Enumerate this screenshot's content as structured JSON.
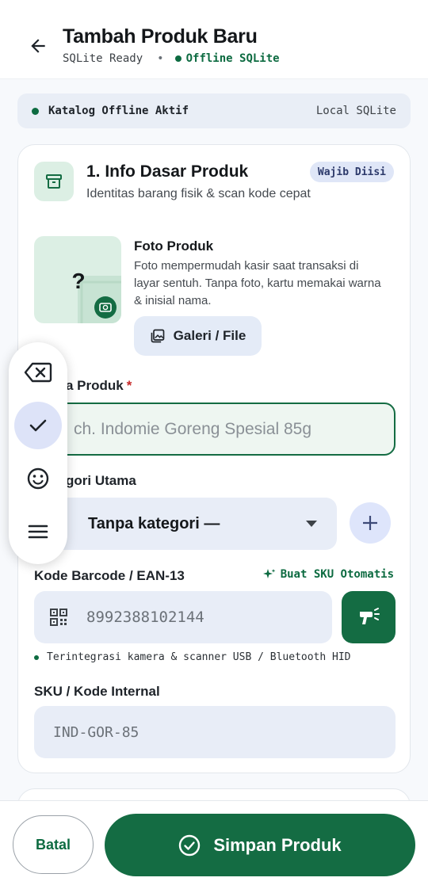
{
  "header": {
    "title": "Tambah Produk Baru",
    "status_db": "SQLite Ready",
    "separator": "•",
    "status_offline": "Offline SQLite"
  },
  "banner": {
    "label": "Katalog Offline Aktif",
    "source": "Local SQLite"
  },
  "section": {
    "title": "1. Info Dasar Produk",
    "description": "Identitas barang fisik & scan kode cepat",
    "badge": "Wajib Diisi"
  },
  "photo": {
    "title": "Foto Produk",
    "description": "Foto mempermudah kasir saat transaksi di layar sentuh. Tanpa foto, kartu memakai warna & inisial nama.",
    "placeholder_glyph": "?",
    "gallery_button": "Galeri / File"
  },
  "fields": {
    "name_label": "a Produk",
    "name_required": "*",
    "name_placeholder": "ch. Indomie Goreng Spesial 85g",
    "category_label": "gori Utama",
    "category_value": "Tanpa kategori —",
    "barcode_label": "Kode Barcode / EAN-13",
    "auto_sku_label": "Buat SKU Otomatis",
    "barcode_placeholder": "8992388102144",
    "scanner_hint": "Terintegrasi kamera & scanner USB / Bluetooth HID",
    "sku_label": "SKU / Kode Internal",
    "sku_placeholder": "IND-GOR-85"
  },
  "toolbar": {
    "items": [
      "backspace-icon",
      "check-icon",
      "emoji-icon",
      "menu-icon"
    ]
  },
  "actions": {
    "cancel": "Batal",
    "save": "Simpan Produk"
  },
  "colors": {
    "primary": "#146c43",
    "accent_green_light": "#dcefe4",
    "input_bg": "#e8edf7",
    "required": "#c62828"
  }
}
